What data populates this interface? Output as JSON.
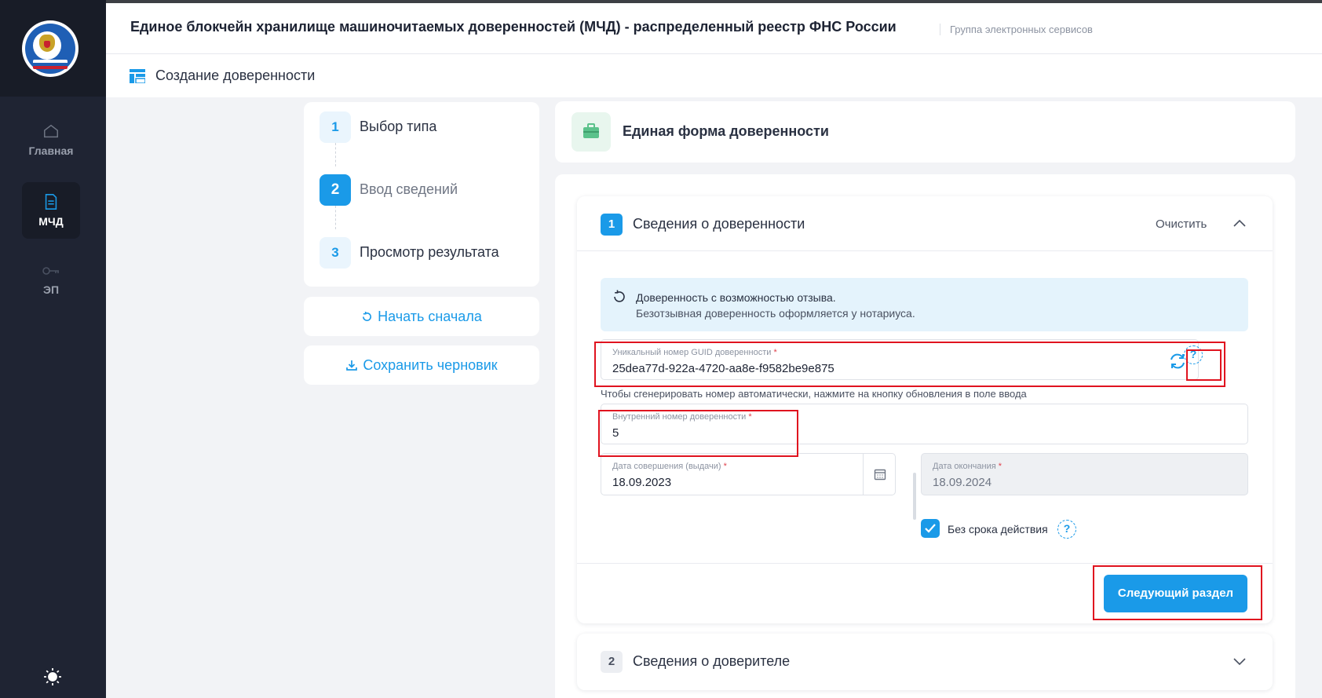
{
  "sidebar": {
    "items": [
      {
        "label": "Главная",
        "icon": "home-icon"
      },
      {
        "label": "МЧД",
        "icon": "document-icon"
      },
      {
        "label": "ЭП",
        "icon": "key-icon"
      }
    ],
    "theme_icon": "sun-icon"
  },
  "header": {
    "title": "Единое блокчейн хранилище машиночитаемых доверенностей (МЧД) - распределенный реестр ФНС России",
    "subtitle": "Группа электронных сервисов"
  },
  "subheader": {
    "title": "Создание доверенности"
  },
  "stepper": {
    "steps": [
      {
        "num": "1",
        "label": "Выбор типа"
      },
      {
        "num": "2",
        "label": "Ввод сведений"
      },
      {
        "num": "3",
        "label": "Просмотр результата"
      }
    ]
  },
  "actions": {
    "restart_label": "Начать сначала",
    "save_draft_label": "Сохранить черновик"
  },
  "form": {
    "title": "Единая форма доверенности",
    "section1": {
      "num": "1",
      "title": "Сведения о доверенности",
      "clear_label": "Очистить",
      "info_line1": "Доверенность с возможностью отзыва.",
      "info_line2": "Безотзывная доверенность оформляется у нотариуса.",
      "guid_label": "Уникальный номер GUID доверенности",
      "guid_value": "25dea77d-922a-4720-aa8e-f9582be9e875",
      "guid_hint": "Чтобы сгенерировать номер автоматически, нажмите на кнопку обновления в поле ввода",
      "internal_label": "Внутренний номер доверенности",
      "internal_value": "5",
      "issue_date_label": "Дата совершения (выдачи)",
      "issue_date_value": "18.09.2023",
      "end_date_label": "Дата окончания",
      "end_date_value": "18.09.2024",
      "no_term_label": "Без срока действия",
      "no_term_checked": true,
      "required_mark": "*",
      "help_mark": "?",
      "next_label": "Следующий раздел"
    },
    "section2": {
      "num": "2",
      "title": "Сведения о доверителе"
    }
  },
  "colors": {
    "accent": "#1a9ae8",
    "sidebar": "#1f2433",
    "highlight": "#e0131f"
  }
}
